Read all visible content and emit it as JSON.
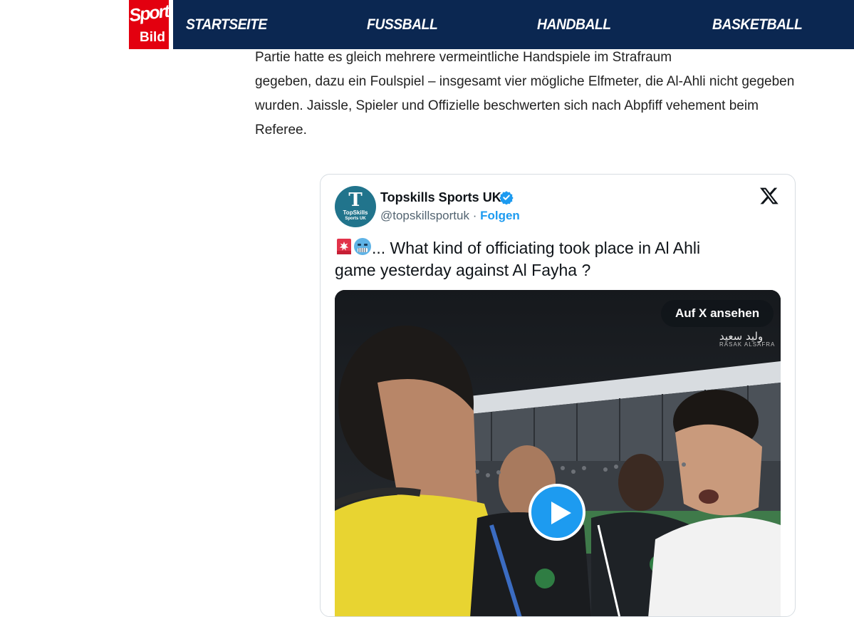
{
  "header": {
    "logo": {
      "line1": "Sport",
      "line2": "Bild"
    },
    "nav": [
      "STARTSEITE",
      "FUSSBALL",
      "HANDBALL",
      "BASKETBALL"
    ],
    "colors": {
      "nav_bg": "#0b2751",
      "logo_bg": "#e3000f"
    }
  },
  "article": {
    "lines": [
      "Partie hatte es gleich mehrere vermeintliche Handspiele im Strafraum",
      "gegeben, dazu ein Foulspiel – insgesamt vier mögliche Elfmeter, die Al-Ahli nicht gegeben",
      "wurden. Jaissle, Spieler und Offizielle beschwerten sich nach Abpfiff vehement beim",
      "Referee."
    ]
  },
  "tweet": {
    "avatar": {
      "glyph": "T",
      "mini1": "TopSkills",
      "mini2": "Sports UK"
    },
    "display_name": "Topskills Sports UK",
    "handle": "@topskillsportuk",
    "separator": " · ",
    "follow_label": "Folgen",
    "text_line1": "... What kind of officiating took place in Al Ahli",
    "text_line2": "game yesterday against Al Fayha ?",
    "emojis": [
      "police-light-emoji",
      "cold-face-emoji"
    ],
    "media": {
      "watch_label": "Auf X ansehen",
      "overlay_arabic": "وليد سعيد",
      "overlay_sub": "RASAK ALSAFRA",
      "play_icon": "play-icon"
    },
    "icons": [
      "verified-badge-icon",
      "x-logo-icon"
    ],
    "colors": {
      "link": "#1d9bf0",
      "muted": "#536471"
    }
  }
}
